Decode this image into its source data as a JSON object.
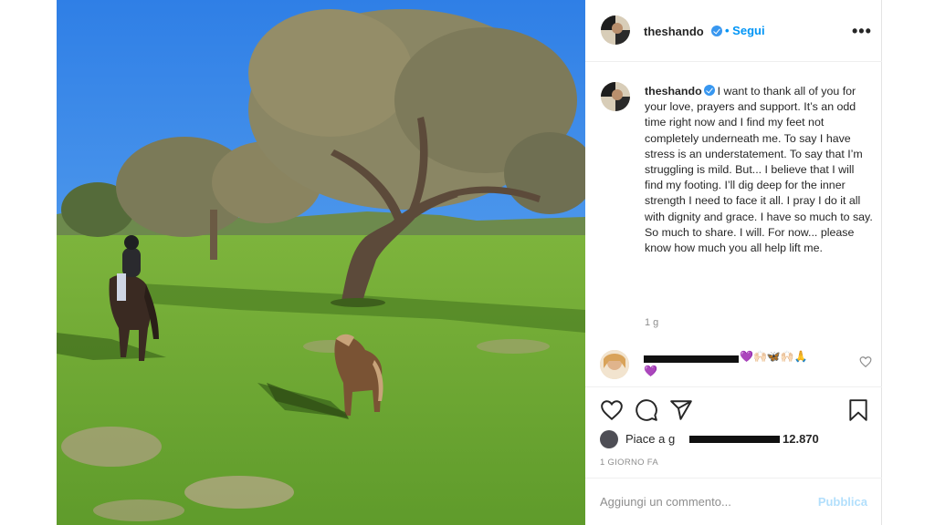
{
  "post": {
    "username": "theshando",
    "follow_label": "Segui",
    "more_label": "•••"
  },
  "caption": {
    "username": "theshando",
    "text": "I want to thank all of you for your love, prayers and support. It’s an odd time right now and I find my feet not completely underneath me. To say I have stress is an understatement. To say that I’m struggling is mild. But... I believe that I will find my footing. I’ll dig deep for the inner strength I need to face it all. I pray I do it all with dignity and grace. I have so much to say. So much to share. I will. For now... please know how much you all help lift me.",
    "time": "1 g"
  },
  "comment": {
    "emojis": "💜🙌🏻🦋🙌🏻🙏",
    "emojis_line2": "💜"
  },
  "actions": {
    "like_icon": "heart-icon",
    "comment_icon": "comment-icon",
    "share_icon": "share-icon",
    "save_icon": "bookmark-icon"
  },
  "likes": {
    "prefix": "Piace a g",
    "count": "12.870"
  },
  "date_label": "1 GIORNO FA",
  "add_comment": {
    "placeholder": "Aggiungi un commento...",
    "publish_label": "Pubblica"
  },
  "colors": {
    "accent": "#0095f6",
    "publish_disabled": "#b2dffc",
    "muted_text": "#8e8e8e"
  }
}
